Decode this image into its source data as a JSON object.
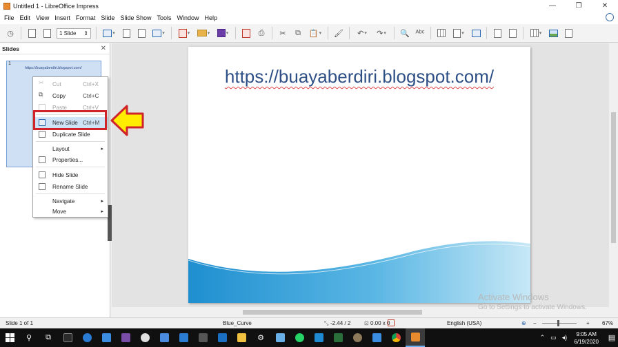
{
  "window": {
    "title": "Untitled 1 - LibreOffice Impress"
  },
  "menu": [
    "File",
    "Edit",
    "View",
    "Insert",
    "Format",
    "Slide",
    "Slide Show",
    "Tools",
    "Window",
    "Help"
  ],
  "toolbar": {
    "slide_combo_value": "1 Slide"
  },
  "slides_panel": {
    "title": "Slides",
    "thumbnail_number": "1",
    "thumbnail_text": "https://buayaberdiri.blogspot.com/"
  },
  "context_menu": [
    {
      "label": "Cut",
      "shortcut": "Ctrl+X",
      "disabled": true
    },
    {
      "label": "Copy",
      "shortcut": "Ctrl+C",
      "disabled": false
    },
    {
      "label": "Paste",
      "shortcut": "Ctrl+V",
      "disabled": true
    },
    {
      "label": "New Slide",
      "shortcut": "Ctrl+M",
      "highlighted": true
    },
    {
      "label": "Duplicate Slide",
      "shortcut": ""
    },
    {
      "label": "Layout",
      "shortcut": "",
      "submenu": true
    },
    {
      "label": "Properties...",
      "shortcut": ""
    },
    {
      "label": "Hide Slide",
      "shortcut": ""
    },
    {
      "label": "Rename Slide",
      "shortcut": ""
    },
    {
      "label": "Navigate",
      "shortcut": "",
      "submenu": true
    },
    {
      "label": "Move",
      "shortcut": "",
      "submenu": true
    }
  ],
  "slide": {
    "title_text": "https://buayaberdiri.blogspot.com/",
    "title_color": "#2e4f86",
    "wave_color": "#2a9ad6"
  },
  "activation": {
    "line1": "Activate Windows",
    "line2": "Go to Settings to activate Windows."
  },
  "status": {
    "slide_info": "Slide 1 of 1",
    "master": "Blue_Curve",
    "position": "-2.44 / 2",
    "size": "0.00 x 0",
    "language": "English (USA)",
    "zoom": "67%"
  },
  "taskbar": {
    "time": "9:05 AM",
    "date": "6/19/2020"
  },
  "colors": {
    "highlight_box": "#d1232a",
    "arrow": "#ffec00"
  }
}
